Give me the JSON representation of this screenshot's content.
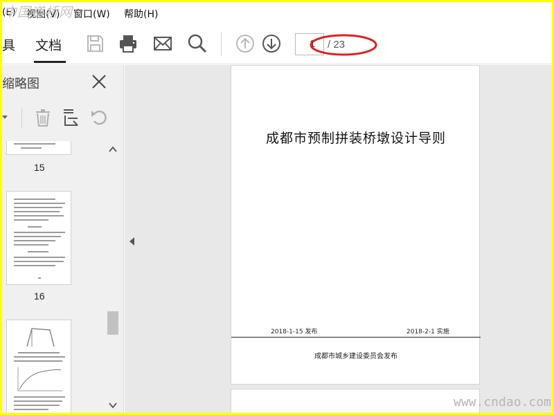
{
  "watermark_top": "中国道桥网",
  "watermark_bottom": "www.cndao.com",
  "menubar": {
    "edit_partial": "(E)",
    "view": "视图(V)",
    "window": "窗口(W)",
    "help": "帮助(H)"
  },
  "toolbar": {
    "tools_tab": "具",
    "document_tab": "文档",
    "page_current": "1",
    "page_total": "/ 23",
    "icons": [
      "save-icon",
      "print-icon",
      "email-icon",
      "search-icon",
      "page-up-icon",
      "page-down-icon"
    ]
  },
  "sidebar": {
    "title": "缩略图",
    "tools": [
      "dropdown-icon",
      "delete-icon",
      "extract-icon",
      "rotate-icon"
    ],
    "thumbnails": [
      {
        "label": "15"
      },
      {
        "label": "16"
      },
      {
        "label": ""
      }
    ]
  },
  "document": {
    "title": "成都市预制拼装桥墩设计导则",
    "issue_date": "2018-1-15  发布",
    "effective_date": "2018-2-1    实施",
    "publisher": "成都市城乡建设委员会发布"
  },
  "colors": {
    "outer_border": "#ffff00",
    "annotation_ellipse": "#e02020",
    "sidebar_bg": "#f0f0f0",
    "doc_bg": "#e8e8e8"
  }
}
